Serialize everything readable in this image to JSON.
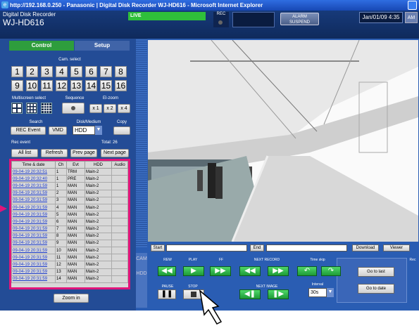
{
  "window": {
    "title": "http://192.168.0.250 - Panasonic | Digital Disk Recorder WJ-HD616 - Microsoft Internet Explorer"
  },
  "header": {
    "subtitle": "Digital Disk Recorder",
    "model": "WJ-HD616",
    "live": "LIVE",
    "rec": "REC",
    "alarm_line1": "ALARM",
    "alarm_line2": "SUSPEND",
    "date": "Jan/01/09  4:35",
    "ampm": "AM"
  },
  "tabs": {
    "control": "Control",
    "setup": "Setup"
  },
  "cam_select": {
    "label": "Cam. select",
    "numbers": [
      "1",
      "2",
      "3",
      "4",
      "5",
      "6",
      "7",
      "8",
      "9",
      "10",
      "11",
      "12",
      "13",
      "14",
      "15",
      "16"
    ]
  },
  "multiscreen": {
    "label": "Multiscreen select"
  },
  "sequence": {
    "label": "Sequence"
  },
  "ezoom": {
    "label": "El-zoom",
    "x1": "x 1",
    "x2": "x 2",
    "x4": "x 4"
  },
  "search": {
    "label": "Search",
    "rec_event": "REC Event",
    "vmd": "VMD"
  },
  "disk": {
    "label": "Disk/Medium",
    "value": "HDD"
  },
  "copy": {
    "label": "Copy"
  },
  "rec_event": {
    "label": "Rec event",
    "total": "Total: 26",
    "all_list": "All list",
    "refresh": "Refresh",
    "prev_page": "Prev page",
    "next_page": "Next page"
  },
  "table": {
    "headers": [
      "Time & date",
      "Ch",
      "Evt",
      "HDD",
      "Audio"
    ],
    "rows": [
      [
        "09-04-19 20:32:51",
        "1",
        "TRM",
        "Main-2"
      ],
      [
        "09-04-19 20:32:40",
        "1",
        "PRE",
        "Main-2"
      ],
      [
        "09-04-19 20:31:59",
        "1",
        "MAN",
        "Main-2"
      ],
      [
        "09-04-19 20:31:59",
        "2",
        "MAN",
        "Main-2"
      ],
      [
        "09-04-19 20:31:59",
        "3",
        "MAN",
        "Main-2"
      ],
      [
        "09-04-19 20:31:59",
        "4",
        "MAN",
        "Main-2"
      ],
      [
        "09-04-19 20:31:59",
        "5",
        "MAN",
        "Main-2"
      ],
      [
        "09-04-19 20:31:59",
        "6",
        "MAN",
        "Main-2"
      ],
      [
        "09-04-19 20:31:59",
        "7",
        "MAN",
        "Main-2"
      ],
      [
        "09-04-19 20:31:59",
        "8",
        "MAN",
        "Main-2"
      ],
      [
        "09-04-19 20:31:59",
        "9",
        "MAN",
        "Main-2"
      ],
      [
        "09-04-19 20:31:59",
        "10",
        "MAN",
        "Main-2"
      ],
      [
        "09-04-19 20:31:59",
        "11",
        "MAN",
        "Main-2"
      ],
      [
        "09-04-19 20:31:59",
        "12",
        "MAN",
        "Main-2"
      ],
      [
        "09-04-19 20:31:59",
        "13",
        "MAN",
        "Main-2"
      ],
      [
        "09-04-19 20:31:59",
        "14",
        "MAN",
        "Main-2"
      ]
    ]
  },
  "zoom_in": "Zoom in",
  "bottom": {
    "start": "Start",
    "end": "End",
    "download": "Download",
    "view": "Viewer"
  },
  "playback": {
    "rew": "REW",
    "play": "PLAY",
    "ff": "FF",
    "next_record": "NEXT RECORD",
    "time_skip": "Time skip",
    "pause": "PAUSE",
    "stop": "STOP",
    "next_image": "NEXT IMAGE",
    "interval": "Interval",
    "interval_value": "30s"
  },
  "rec_side": "Rec",
  "go_to_last": "Go to last",
  "go_to_date": "Go to date",
  "cam_vertical": "CAM",
  "hdd_vertical": "HDD"
}
